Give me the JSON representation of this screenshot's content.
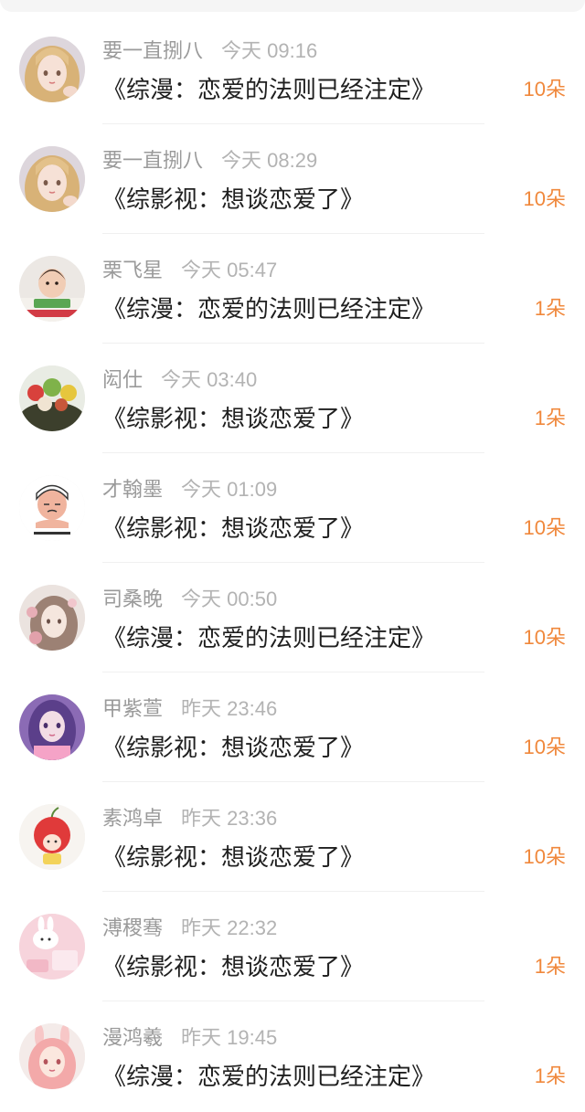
{
  "records": [
    {
      "user": "要一直捌八",
      "time": "今天 09:16",
      "book": "《综漫：恋爱的法则已经注定》",
      "count": "10朵",
      "avatar": "avatar-blonde-anime-girl"
    },
    {
      "user": "要一直捌八",
      "time": "今天 08:29",
      "book": "《综影视：想谈恋爱了》",
      "count": "10朵",
      "avatar": "avatar-blonde-anime-girl"
    },
    {
      "user": "栗飞星",
      "time": "今天 05:47",
      "book": "《综漫：恋爱的法则已经注定》",
      "count": "1朵",
      "avatar": "avatar-baby-photo"
    },
    {
      "user": "闳仕",
      "time": "今天 03:40",
      "book": "《综影视：想谈恋爱了》",
      "count": "1朵",
      "avatar": "avatar-food-bowl"
    },
    {
      "user": "才翰墨",
      "time": "今天 01:09",
      "book": "《综影视：想谈恋爱了》",
      "count": "10朵",
      "avatar": "avatar-cartoon-meme"
    },
    {
      "user": "司桑晚",
      "time": "今天 00:50",
      "book": "《综漫：恋爱的法则已经注定》",
      "count": "10朵",
      "avatar": "avatar-anime-girl-flowers"
    },
    {
      "user": "甲紫萱",
      "time": "昨天 23:46",
      "book": "《综影视：想谈恋爱了》",
      "count": "10朵",
      "avatar": "avatar-purple-hair-girl"
    },
    {
      "user": "素鸿卓",
      "time": "昨天 23:36",
      "book": "《综影视：想谈恋爱了》",
      "count": "10朵",
      "avatar": "avatar-cherry-cartoon"
    },
    {
      "user": "溥稷骞",
      "time": "昨天 22:32",
      "book": "《综影视：想谈恋爱了》",
      "count": "1朵",
      "avatar": "avatar-pink-bunny"
    },
    {
      "user": "漫鸿羲",
      "time": "昨天 19:45",
      "book": "《综漫：恋爱的法则已经注定》",
      "count": "1朵",
      "avatar": "avatar-pink-bunny-ear-girl"
    }
  ],
  "colors": {
    "accent": "#f0883c",
    "username": "#9a9a9a",
    "time": "#b3b3b3",
    "title": "#1f1f1f"
  }
}
